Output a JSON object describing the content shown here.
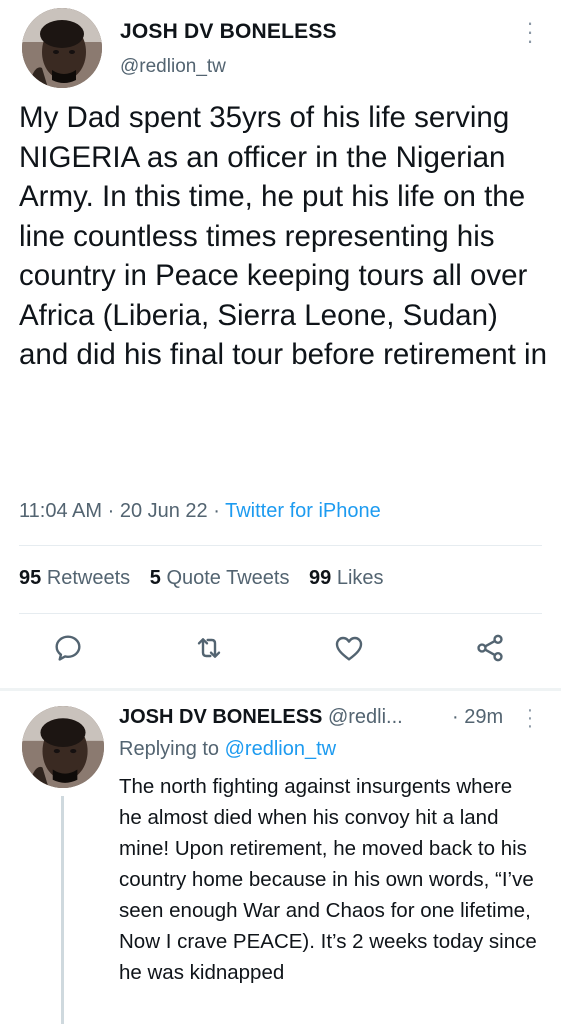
{
  "main_tweet": {
    "author_name": "JOSH DV BONELESS",
    "author_handle": "@redlion_tw",
    "text": "My Dad spent 35yrs of his life serving NIGERIA as an officer in the Nigerian Army. In this time, he put his life on the line countless times representing his country in Peace keeping tours all over Africa (Liberia, Sierra Leone, Sudan) and did his final tour before retirement in",
    "time": "11:04 AM",
    "date": "20 Jun 22",
    "source": "Twitter for iPhone",
    "dot": "·",
    "stats": {
      "retweets_count": "95",
      "retweets_label": "Retweets",
      "quote_count": "5",
      "quote_label": "Quote Tweets",
      "likes_count": "99",
      "likes_label": "Likes"
    },
    "actions": [
      "reply-icon",
      "retweet-icon",
      "like-icon",
      "share-icon"
    ]
  },
  "reply_tweet": {
    "author_name": "JOSH DV BONELESS",
    "author_handle": "@redli...",
    "time": "· 29m",
    "replying_prefix": "Replying to",
    "replying_mention": "@redlion_tw",
    "text": "The north fighting against insurgents where he almost died when his convoy hit a land mine! Upon retirement, he moved back to his country home because in his own words, “I’ve seen enough War and Chaos for one lifetime, Now I crave PEACE). It’s 2 weeks today since he was kidnapped"
  },
  "colors": {
    "accent": "#1d9bf0",
    "secondary_text": "#536471",
    "primary_text": "#0f1419"
  }
}
